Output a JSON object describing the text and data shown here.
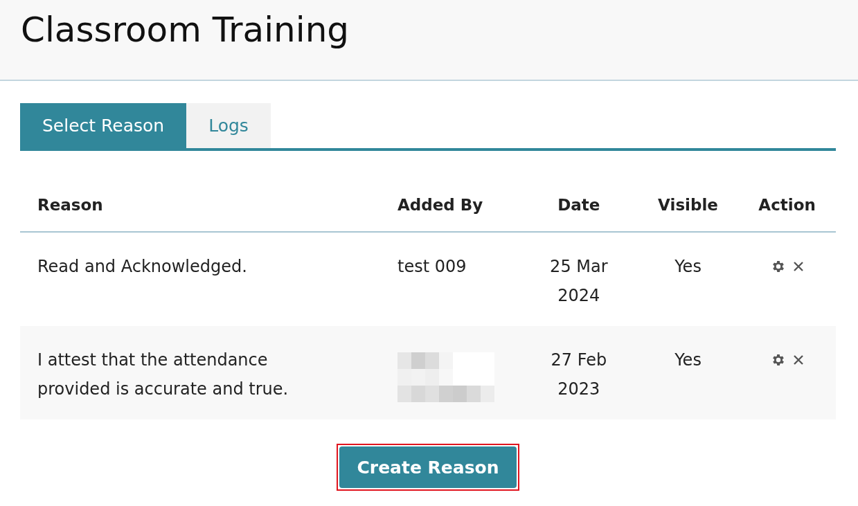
{
  "page": {
    "title": "Classroom Training"
  },
  "tabs": [
    {
      "label": "Select Reason",
      "selected": true
    },
    {
      "label": "Logs",
      "selected": false
    }
  ],
  "table": {
    "columns": [
      "Reason",
      "Added By",
      "Date",
      "Visible",
      "Action"
    ],
    "rows": [
      {
        "reason": "Read and Acknowledged.",
        "added_by": "test 009",
        "date": "25 Mar 2024",
        "visible": "Yes"
      },
      {
        "reason": "I attest that the attendance provided is accurate and true.",
        "added_by_redacted": true,
        "date": "27 Feb 2023",
        "visible": "Yes"
      }
    ]
  },
  "create_button": {
    "label": "Create Reason",
    "focused": true
  }
}
